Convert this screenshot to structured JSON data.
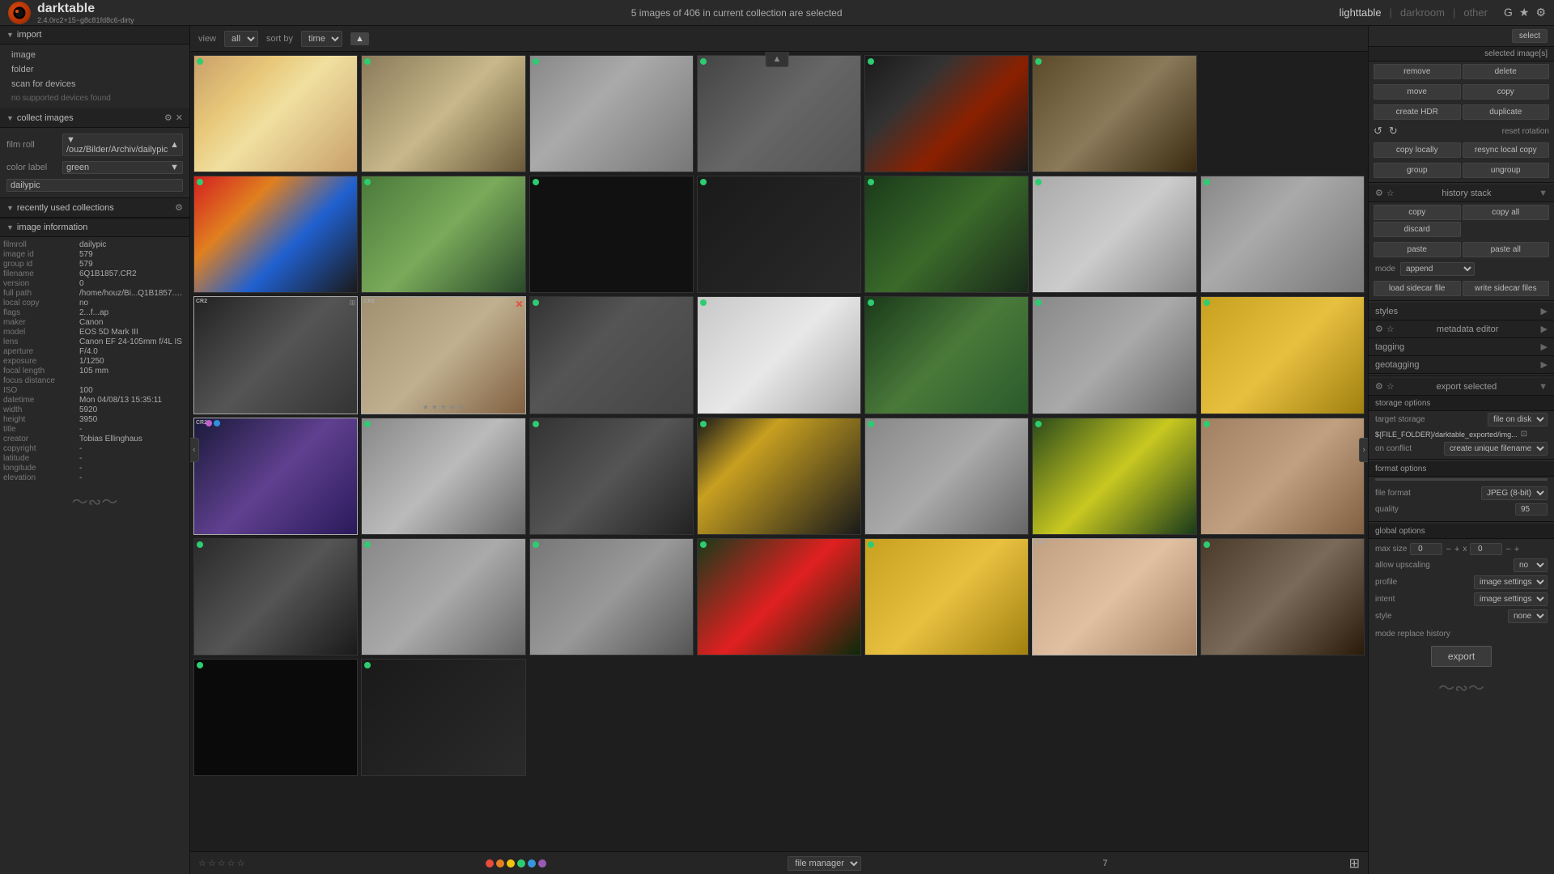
{
  "app": {
    "name": "darktable",
    "version": "2.4.0rc2+15~g8c81fd8c6-dirty",
    "logo": "dt"
  },
  "header": {
    "selection_info": "5 images of 406 in current collection are selected",
    "nav": {
      "lighttable": "lighttable",
      "darkroom": "darkroom",
      "other": "other"
    },
    "nav_icons": [
      "G",
      "★",
      "⚙"
    ]
  },
  "toolbar": {
    "view_label": "view",
    "view_value": "all",
    "sort_label": "sort by",
    "sort_value": "time",
    "sort_direction": "▲"
  },
  "left_panel": {
    "import": {
      "title": "import",
      "items": [
        "image",
        "folder",
        "scan for devices",
        "no supported devices found"
      ]
    },
    "collect": {
      "title": "collect images",
      "film_roll": {
        "label": "film roll",
        "value": "/ouz/Bilder/Archiv/dailypic"
      },
      "color_label": {
        "label": "color label",
        "value": "green"
      },
      "filter_value": "dailypic"
    },
    "recently": {
      "title": "recently used collections"
    },
    "image_info": {
      "title": "image information",
      "fields": [
        {
          "key": "filmroll",
          "val": "dailypic"
        },
        {
          "key": "image id",
          "val": "579"
        },
        {
          "key": "group id",
          "val": "579"
        },
        {
          "key": "filename",
          "val": "6Q1B1857.CR2"
        },
        {
          "key": "version",
          "val": "0"
        },
        {
          "key": "full path",
          "val": "/home/houz/Bi...Q1B1857.CR2"
        },
        {
          "key": "local copy",
          "val": "no"
        },
        {
          "key": "flags",
          "val": "2...f...ap"
        },
        {
          "key": "maker",
          "val": "Canon"
        },
        {
          "key": "model",
          "val": "EOS 5D Mark III"
        },
        {
          "key": "lens",
          "val": "Canon EF 24-105mm f/4L IS"
        },
        {
          "key": "aperture",
          "val": "F/4.0"
        },
        {
          "key": "exposure",
          "val": "1/1250"
        },
        {
          "key": "focal length",
          "val": "105 mm"
        },
        {
          "key": "focus distance",
          "val": ""
        },
        {
          "key": "ISO",
          "val": "100"
        },
        {
          "key": "datetime",
          "val": "Mon 04/08/13 15:35:11"
        },
        {
          "key": "width",
          "val": "5920"
        },
        {
          "key": "height",
          "val": "3950"
        },
        {
          "key": "title",
          "val": "-"
        },
        {
          "key": "creator",
          "val": "Tobias Ellinghaus"
        },
        {
          "key": "copyright",
          "val": "-"
        },
        {
          "key": "latitude",
          "val": "-"
        },
        {
          "key": "longitude",
          "val": "-"
        },
        {
          "key": "elevation",
          "val": "-"
        }
      ]
    }
  },
  "thumbnails": [
    {
      "id": "egg",
      "class": "photo-egg",
      "dot": "green",
      "cr2": false,
      "label": "egg photo"
    },
    {
      "id": "owl",
      "class": "photo-owl",
      "dot": "green",
      "cr2": false,
      "label": "owl photo"
    },
    {
      "id": "glove",
      "class": "photo-glove",
      "dot": "green",
      "cr2": false,
      "label": "glove photo"
    },
    {
      "id": "building",
      "class": "photo-building",
      "dot": "green",
      "cr2": false,
      "label": "building photo"
    },
    {
      "id": "dark",
      "class": "photo-dark",
      "dot": "green",
      "cr2": false,
      "label": "dark photo"
    },
    {
      "id": "deer",
      "class": "photo-deer",
      "dot": "green",
      "cr2": false,
      "label": "deer photo"
    },
    {
      "id": "picks",
      "class": "photo-picks",
      "dot": "green",
      "cr2": false,
      "label": "guitar picks photo"
    },
    {
      "id": "catkins",
      "class": "photo-catkins",
      "dot": "green",
      "cr2": false,
      "label": "catkins photo"
    },
    {
      "id": "black",
      "class": "photo-black",
      "dot": "green",
      "cr2": false,
      "label": "black photo"
    },
    {
      "id": "dark2",
      "class": "photo-dark2",
      "dot": "green",
      "cr2": false,
      "label": "dark photo 2"
    },
    {
      "id": "fern",
      "class": "photo-fern",
      "dot": "green",
      "cr2": false,
      "label": "fern photo"
    },
    {
      "id": "sink",
      "class": "photo-sink",
      "dot": "green",
      "cr2": false,
      "label": "sink photo"
    },
    {
      "id": "crack",
      "class": "photo-crack",
      "dot": "green",
      "cr2": false,
      "label": "crack photo"
    },
    {
      "id": "skater",
      "class": "photo-skater",
      "dot": "yellow",
      "cr2": true,
      "label": "skater photo"
    },
    {
      "id": "texture",
      "class": "photo-texture",
      "dot": "yellow",
      "cr2": true,
      "label": "texture photo"
    },
    {
      "id": "metro",
      "class": "photo-metro",
      "dot": "green",
      "cr2": false,
      "label": "metro photo"
    },
    {
      "id": "sign",
      "class": "photo-sign",
      "dot": "green",
      "cr2": false,
      "label": "sign photo"
    },
    {
      "id": "plant",
      "class": "photo-plant",
      "dot": "green",
      "cr2": false,
      "label": "plant photo"
    },
    {
      "id": "pear",
      "class": "photo-pear",
      "dot": "green",
      "cr2": false,
      "label": "pear photo"
    },
    {
      "id": "drinks",
      "class": "photo-drinks",
      "dot": "green",
      "cr2": false,
      "label": "drinks photo"
    },
    {
      "id": "hair",
      "class": "photo-hair",
      "dot": "yellow",
      "cr2": true,
      "label": "hair photo"
    },
    {
      "id": "clock",
      "class": "photo-clock",
      "dot": "green",
      "cr2": false,
      "label": "clock photo"
    },
    {
      "id": "car",
      "class": "photo-car",
      "dot": "green",
      "cr2": false,
      "label": "car photo"
    },
    {
      "id": "lights",
      "class": "photo-lights",
      "dot": "green",
      "cr2": false,
      "label": "lights photo"
    },
    {
      "id": "graffiti",
      "class": "photo-graffiti",
      "dot": "green",
      "cr2": false,
      "label": "graffiti photo"
    },
    {
      "id": "yellow",
      "class": "photo-yellow",
      "dot": "green",
      "cr2": false,
      "label": "yellow flower photo"
    },
    {
      "id": "dog",
      "class": "photo-dog",
      "dot": "green",
      "cr2": false,
      "label": "dog photo"
    },
    {
      "id": "arch",
      "class": "photo-arch",
      "dot": "green",
      "cr2": false,
      "label": "arch photo"
    },
    {
      "id": "ruins",
      "class": "photo-ruins",
      "dot": "green",
      "cr2": false,
      "label": "ruins photo"
    },
    {
      "id": "stone",
      "class": "photo-stone",
      "dot": "green",
      "cr2": false,
      "label": "stone photo"
    },
    {
      "id": "tulip",
      "class": "photo-tulip",
      "dot": "green",
      "cr2": false,
      "label": "tulip photo"
    },
    {
      "id": "jar",
      "class": "photo-jar",
      "dot": "green",
      "cr2": false,
      "label": "jar photo"
    },
    {
      "id": "shell",
      "class": "photo-shell",
      "dot": "yellow",
      "cr2": true,
      "label": "shell photo"
    },
    {
      "id": "door",
      "class": "photo-door",
      "dot": "green",
      "cr2": false,
      "label": "door photo"
    },
    {
      "id": "dark3",
      "class": "photo-dark3",
      "dot": "green",
      "cr2": false,
      "label": "dark photo 3"
    }
  ],
  "bottom_bar": {
    "view_mode": "file manager",
    "page_num": "7",
    "color_dots": [
      "#e74c3c",
      "#e67e22",
      "#f1c40f",
      "#2ecc71",
      "#3498db",
      "#9b59b6"
    ]
  },
  "right_panel": {
    "select_label": "select",
    "selected_images": "selected image[s]",
    "actions": {
      "remove": "remove",
      "delete": "delete",
      "move": "move",
      "copy": "copy",
      "create_hdr": "create HDR",
      "duplicate": "duplicate",
      "reset_rotation": "reset rotation",
      "copy_locally": "copy locally",
      "resync_local_copy": "resync local copy",
      "group": "group",
      "ungroup": "ungroup"
    },
    "history": {
      "title": "history stack",
      "copy": "copy",
      "copy_all": "copy all",
      "discard": "discard",
      "paste": "paste",
      "paste_all": "paste all",
      "mode_label": "mode",
      "mode_value": "append",
      "load_sidecar": "load sidecar file",
      "write_sidecar": "write sidecar files"
    },
    "styles": {
      "title": "styles"
    },
    "metadata_editor": {
      "title": "metadata editor"
    },
    "tagging": {
      "title": "tagging"
    },
    "geotagging": {
      "title": "geotagging"
    },
    "export": {
      "title": "export selected",
      "storage_options": "storage options",
      "target_storage_label": "target storage",
      "target_storage_value": "file on disk",
      "path": "${FILE_FOLDER}/darktable_exported/img...",
      "on_conflict_label": "on conflict",
      "on_conflict_value": "create unique filename",
      "format_options": "format options",
      "file_format_label": "file format",
      "file_format_value": "JPEG (8-bit)",
      "quality_label": "quality",
      "quality_value": "95",
      "global_options": "global options",
      "max_size_label": "max size",
      "max_size_w": "0",
      "max_size_x": "x",
      "max_size_h": "0",
      "allow_upscaling_label": "allow upscaling",
      "allow_upscaling_value": "no",
      "profile_label": "profile",
      "profile_value": "image settings",
      "intent_label": "intent",
      "intent_value": "image settings",
      "style_label": "style",
      "style_value": "none",
      "mode_label": "mode replace history",
      "export_btn": "export"
    }
  }
}
